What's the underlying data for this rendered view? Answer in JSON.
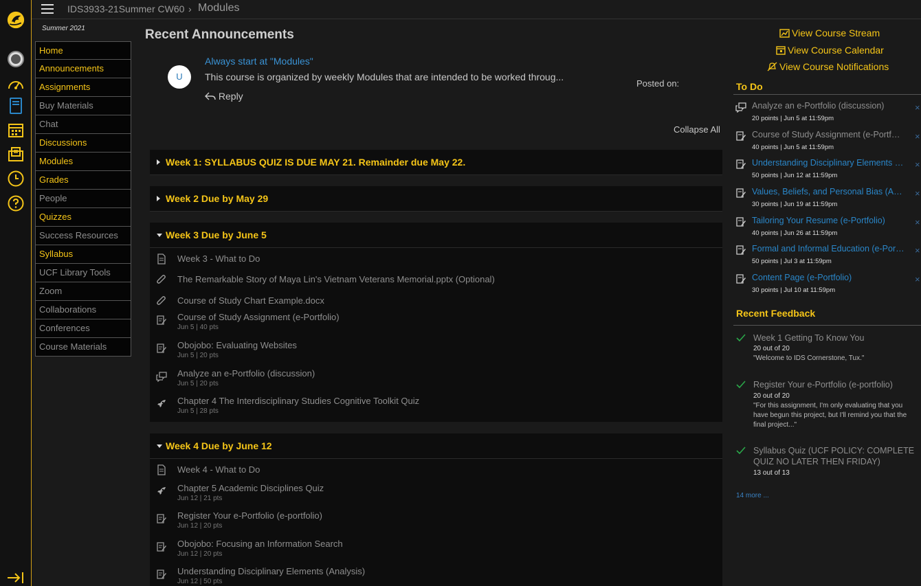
{
  "topbar": {
    "course_code": "IDS3933-21Summer CW60",
    "separator": "›",
    "current": "Modules"
  },
  "course_nav": {
    "term": "Summer 2021",
    "items": [
      {
        "label": "Home",
        "active": true
      },
      {
        "label": "Announcements",
        "active": true
      },
      {
        "label": "Assignments",
        "active": true
      },
      {
        "label": "Buy Materials",
        "active": false
      },
      {
        "label": "Chat",
        "active": false
      },
      {
        "label": "Discussions",
        "active": true
      },
      {
        "label": "Modules",
        "active": true
      },
      {
        "label": "Grades",
        "active": true
      },
      {
        "label": "People",
        "active": false
      },
      {
        "label": "Quizzes",
        "active": true
      },
      {
        "label": "Success Resources",
        "active": false
      },
      {
        "label": "Syllabus",
        "active": true
      },
      {
        "label": "UCF Library Tools",
        "active": false
      },
      {
        "label": "Zoom",
        "active": false
      },
      {
        "label": "Collaborations",
        "active": false
      },
      {
        "label": "Conferences",
        "active": false
      },
      {
        "label": "Course Materials",
        "active": false
      }
    ]
  },
  "announcements": {
    "heading": "Recent Announcements",
    "avatar_letter": "U",
    "title": "Always start at \"Modules\"",
    "body": "This course is organized by weekly Modules that are intended to be worked throug...",
    "reply": "Reply",
    "posted_on": "Posted on:"
  },
  "collapse_all": "Collapse All",
  "modules": [
    {
      "title": "Week 1: SYLLABUS QUIZ IS DUE MAY 21. Remainder due May 22.",
      "expanded": false,
      "items": []
    },
    {
      "title": "Week 2 Due by May 29",
      "expanded": false,
      "items": []
    },
    {
      "title": "Week 3 Due by June 5",
      "expanded": true,
      "items": [
        {
          "icon": "page-icon",
          "title": "Week 3 - What to Do",
          "meta": ""
        },
        {
          "icon": "attachment-icon",
          "title": "The Remarkable Story of Maya Lin's Vietnam Veterans Memorial.pptx (Optional)",
          "meta": ""
        },
        {
          "icon": "attachment-icon",
          "title": "Course of Study Chart Example.docx",
          "meta": ""
        },
        {
          "icon": "assignment-icon",
          "title": "Course of Study Assignment (e-Portfolio)",
          "meta": "Jun 5  |  40 pts"
        },
        {
          "icon": "assignment-icon",
          "title": "Obojobo: Evaluating Websites",
          "meta": "Jun 5  |  20 pts"
        },
        {
          "icon": "discussion-icon",
          "title": "Analyze an e-Portfolio (discussion)",
          "meta": "Jun 5  |  20 pts"
        },
        {
          "icon": "quiz-icon",
          "title": "Chapter 4 The Interdisciplinary Studies Cognitive Toolkit Quiz",
          "meta": "Jun 5  |  28 pts"
        }
      ]
    },
    {
      "title": "Week 4 Due by June 12",
      "expanded": true,
      "items": [
        {
          "icon": "page-icon",
          "title": "Week 4 - What to Do",
          "meta": ""
        },
        {
          "icon": "quiz-icon",
          "title": "Chapter 5 Academic Disciplines Quiz",
          "meta": "Jun 12  |  21 pts"
        },
        {
          "icon": "assignment-icon",
          "title": "Register Your e-Portfolio (e-portfolio)",
          "meta": "Jun 12  |  20 pts"
        },
        {
          "icon": "assignment-icon",
          "title": "Obojobo: Focusing an Information Search",
          "meta": "Jun 12  |  20 pts"
        },
        {
          "icon": "assignment-icon",
          "title": "Understanding Disciplinary Elements (Analysis)",
          "meta": "Jun 12  |  50 pts"
        }
      ]
    }
  ],
  "sidebar": {
    "links": [
      "View Course Stream",
      "View Course Calendar",
      "View Course Notifications"
    ],
    "todo_heading": "To Do",
    "todo": [
      {
        "icon": "discussion-icon",
        "title": "Analyze an e-Portfolio (discussion)",
        "meta": "20 points  |  Jun 5 at 11:59pm",
        "color": "#8e8e8e"
      },
      {
        "icon": "assignment-icon",
        "title": "Course of Study Assignment (e-Portfolio)",
        "meta": "40 points  |  Jun 5 at 11:59pm",
        "color": "#8e8e8e"
      },
      {
        "icon": "assignment-icon",
        "title": "Understanding Disciplinary Elements (Analysis)",
        "meta": "50 points  |  Jun 12 at 11:59pm",
        "color": "#2a86c8"
      },
      {
        "icon": "assignment-icon",
        "title": "Values, Beliefs, and Personal Bias (Analysis)",
        "meta": "30 points  |  Jun 19 at 11:59pm",
        "color": "#2a86c8"
      },
      {
        "icon": "assignment-icon",
        "title": "Tailoring Your Resume (e-Portfolio)",
        "meta": "40 points  |  Jun 26 at 11:59pm",
        "color": "#2a86c8"
      },
      {
        "icon": "assignment-icon",
        "title": "Formal and Informal Education (e-Portfolio)",
        "meta": "50 points  |  Jul 3 at 11:59pm",
        "color": "#2a86c8"
      },
      {
        "icon": "assignment-icon",
        "title": "Content Page (e-Portfolio)",
        "meta": "30 points  |  Jul 10 at 11:59pm",
        "color": "#2a86c8"
      }
    ],
    "dismiss": "×",
    "feedback_heading": "Recent Feedback",
    "feedback": [
      {
        "title": "Week 1 Getting To Know You",
        "score": "20 out of 20",
        "comment": "\"Welcome to IDS Cornerstone, Tux.\""
      },
      {
        "title": "Register Your e-Portfolio (e-portfolio)",
        "score": "20 out of 20",
        "comment": "\"For this assignment, I'm only evaluating that you have begun this project, but I'll remind you that the final project...\""
      },
      {
        "title": "Syllabus Quiz (UCF POLICY: COMPLETE QUIZ NO LATER THEN FRIDAY)",
        "score": "13 out of 13",
        "comment": ""
      }
    ],
    "more": "14 more ..."
  },
  "colors": {
    "accent": "#f5c518",
    "link": "#2a86c8",
    "success": "#2aa84a"
  }
}
